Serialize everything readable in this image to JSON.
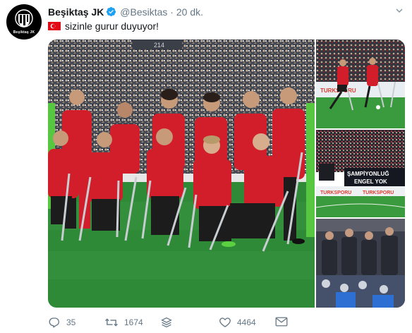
{
  "account": {
    "display_name": "Beşiktaş JK",
    "handle": "@Besiktas",
    "separator": "·",
    "time": "20 dk.",
    "avatar_label": "Beşiktaş JK"
  },
  "tweet": {
    "flag_icon": "turkey-flag-icon",
    "text": "sizinle gurur duyuyor!"
  },
  "media": {
    "photo_count": 4,
    "banner_text_1": "ŞAMPİYONLUĞ",
    "banner_text_2": "ENGEL YOK",
    "sponsor_text": "TURKSPORU",
    "stadium_sign": "214"
  },
  "actions": {
    "reply_count": "35",
    "retweet_count": "1674",
    "like_count": "4464",
    "icons": [
      "reply-icon",
      "retweet-icon",
      "stack-icon",
      "like-icon",
      "message-icon"
    ]
  },
  "colors": {
    "accent": "#1da1f2",
    "pitch": "#2f8a38",
    "kit_red": "#d21e2a",
    "flag_red": "#e30a17"
  }
}
